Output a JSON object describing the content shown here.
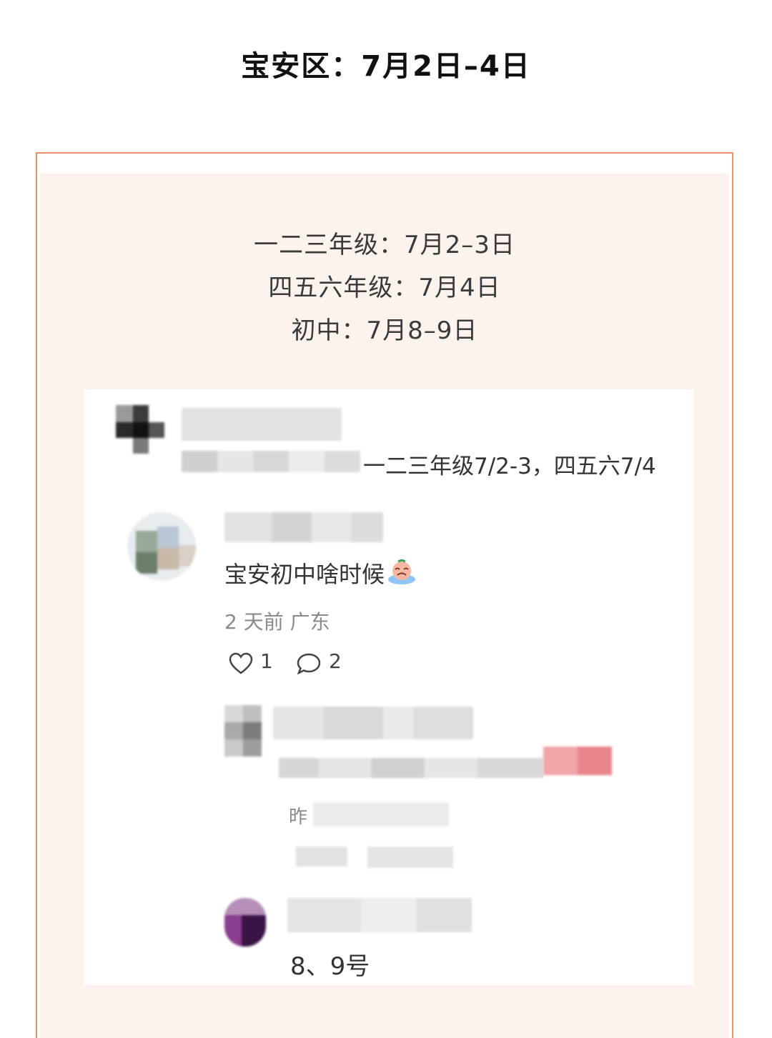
{
  "header": {
    "title": "宝安区：7月2日–4日"
  },
  "schedule": {
    "lines": [
      "一二三年级：7月2–3日",
      "四五六年级：7月4日",
      "初中：7月8–9日"
    ]
  },
  "screenshot": {
    "comment1": {
      "text_partial": "一二三年级7/2-3，四五六7/4"
    },
    "comment2": {
      "text": "宝安初中啥时候",
      "emoji": "crying-face-emoji",
      "meta": "2 天前 广东",
      "likes": "1",
      "replies": "2"
    },
    "reply1": {
      "meta_partial": "昨"
    },
    "reply2": {
      "text": "8、9号"
    }
  },
  "colors": {
    "accent_border": "#e9926a",
    "card_bg": "#fcf3ee"
  }
}
